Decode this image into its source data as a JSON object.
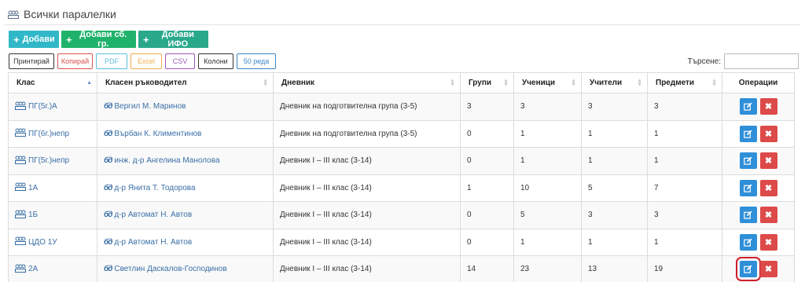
{
  "page": {
    "title": "Всички паралелки"
  },
  "add_buttons": [
    {
      "label": "Добави"
    },
    {
      "label": "Добави сб. гр."
    },
    {
      "label": "Добави ИФО"
    }
  ],
  "export_buttons": [
    {
      "label": "Принтирай",
      "color": "#333333"
    },
    {
      "label": "Копирай",
      "color": "#d9534f"
    },
    {
      "label": "PDF",
      "color": "#5bc0de"
    },
    {
      "label": "Excel",
      "color": "#f0ad4e"
    },
    {
      "label": "CSV",
      "color": "#9b59b6"
    },
    {
      "label": "Колони",
      "color": "#333333"
    },
    {
      "label": "50 реда",
      "color": "#3a86c8"
    }
  ],
  "search": {
    "label": "Търсене:",
    "value": ""
  },
  "table": {
    "columns": [
      "Клас",
      "Класен ръководител",
      "Дневник",
      "Групи",
      "Ученици",
      "Учители",
      "Предмети",
      "Операции"
    ],
    "sorted_column": "Клас",
    "rows": [
      {
        "class": "ПГ(5г.)А",
        "teacher": "Вергил М. Маринов",
        "diary": "Дневник на подготвителна група (3-5)",
        "groups": "3",
        "students": "3",
        "teachers": "3",
        "subjects": "3"
      },
      {
        "class": "ПГ(6г.)непр",
        "teacher": "Върбан К. Климентинов",
        "diary": "Дневник на подготвителна група (3-5)",
        "groups": "0",
        "students": "1",
        "teachers": "1",
        "subjects": "1"
      },
      {
        "class": "ПГ(5г.)непр",
        "teacher": "инж. д-р Ангелина Манолова",
        "diary": "Дневник I – III клас (3-14)",
        "groups": "0",
        "students": "1",
        "teachers": "1",
        "subjects": "1"
      },
      {
        "class": "1А",
        "teacher": "д-р Янита Т. Тодорова",
        "diary": "Дневник I – III клас (3-14)",
        "groups": "1",
        "students": "10",
        "teachers": "5",
        "subjects": "7"
      },
      {
        "class": "1Б",
        "teacher": "д-р Автомат Н. Автов",
        "diary": "Дневник I – III клас (3-14)",
        "groups": "0",
        "students": "5",
        "teachers": "3",
        "subjects": "3"
      },
      {
        "class": "ЦДО 1У",
        "teacher": "д-р Автомат Н. Автов",
        "diary": "Дневник I – III клас (3-14)",
        "groups": "0",
        "students": "1",
        "teachers": "1",
        "subjects": "1"
      },
      {
        "class": "2А",
        "teacher": "Светлин Даскалов-Господинов",
        "diary": "Дневник I – III клас (3-14)",
        "groups": "14",
        "students": "23",
        "teachers": "13",
        "subjects": "19",
        "edit_highlighted": true
      }
    ]
  },
  "icons": {
    "class": "users-group-icon",
    "teacher": "teacher-icon",
    "edit": "edit-icon",
    "delete": "delete-icon"
  },
  "colors": {
    "add_cyan": "#31b8c8",
    "add_green": "#1fb26b",
    "add_teal": "#2aa88a",
    "edit": "#2f8fd9",
    "delete": "#dd4a4a",
    "highlight": "#cc1f2c",
    "link": "#3a6fa6"
  }
}
